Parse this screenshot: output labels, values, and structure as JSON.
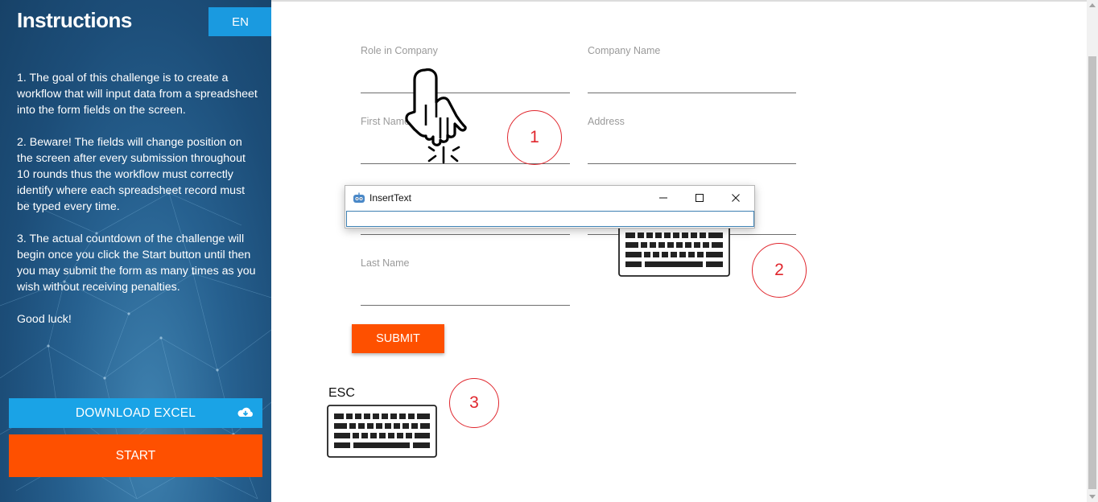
{
  "sidebar": {
    "title": "Instructions",
    "language_button": "EN",
    "instructions": [
      "1. The goal of this challenge is to create a workflow that will input data from a spreadsheet into the form fields on the screen.",
      "2. Beware! The fields will change position on the screen after every submission throughout 10 rounds thus the workflow must correctly identify where each spreadsheet record must be typed every time.",
      "3. The actual countdown of the challenge will begin once you click the Start button until then you may submit the form as many times as you wish without receiving penalties.",
      "Good luck!"
    ],
    "download_button": "DOWNLOAD EXCEL",
    "download_icon": "cloud-download-icon",
    "start_button": "START"
  },
  "form": {
    "fields": [
      {
        "label": "Role in Company",
        "value": ""
      },
      {
        "label": "Company Name",
        "value": ""
      },
      {
        "label": "First Name",
        "value": ""
      },
      {
        "label": "Address",
        "value": ""
      },
      {
        "label": "",
        "value": ""
      },
      {
        "label": "",
        "value": ""
      },
      {
        "label": "Last Name",
        "value": ""
      }
    ],
    "submit_button": "SUBMIT"
  },
  "overlay": {
    "steps": [
      "1",
      "2",
      "3"
    ],
    "esc_label": "ESC",
    "accent_color": "#e0262d",
    "icons": [
      "click-hand-icon",
      "keyboard-icon",
      "keyboard-icon"
    ]
  },
  "insert_text_window": {
    "title": "InsertText",
    "input_value": "",
    "controls": [
      "minimize",
      "maximize",
      "close"
    ]
  },
  "colors": {
    "primary_orange": "#fe5000",
    "primary_blue": "#1aa3e6",
    "sidebar_dark": "#1c4d78"
  }
}
